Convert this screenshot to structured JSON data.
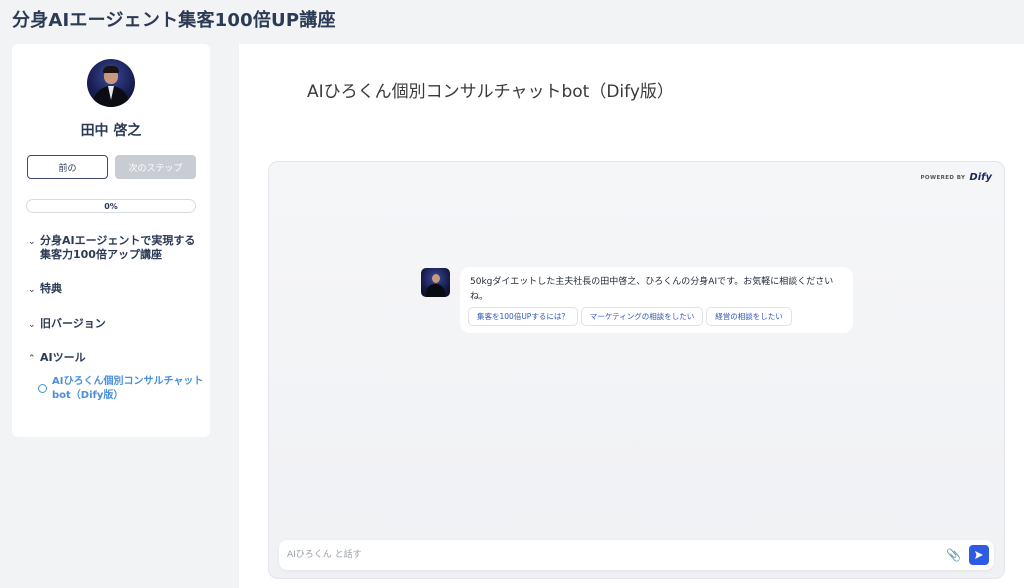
{
  "header": {
    "title": "分身AIエージェント集客100倍UP講座"
  },
  "sidebar": {
    "user_name": "田中 啓之",
    "prev_label": "前の",
    "next_label": "次のステップ",
    "progress": {
      "value": 0,
      "label": "0%"
    },
    "sections": [
      {
        "label": "分身AIエージェントで実現する集客力100倍アップ講座",
        "expanded": false,
        "icon": "chevron-down-icon"
      },
      {
        "label": "特典",
        "expanded": false,
        "icon": "chevron-down-icon"
      },
      {
        "label": "旧バージョン",
        "expanded": false,
        "icon": "chevron-down-icon"
      },
      {
        "label": "AIツール",
        "expanded": true,
        "icon": "chevron-up-icon",
        "items": [
          {
            "label": "AIひろくん個別コンサルチャットbot（Dify版）",
            "active": true
          }
        ]
      }
    ]
  },
  "main": {
    "title": "AIひろくん個別コンサルチャットbot（Dify版）",
    "chat": {
      "powered_by": "POWERED BY",
      "brand": "Dify",
      "bot_message": "50kgダイエットした主夫社長の田中啓之、ひろくんの分身AIです。お気軽に相談くださいね。",
      "suggestions": [
        "集客を100倍UPするには？",
        "マーケティングの相談をしたい",
        "経営の相談をしたい"
      ],
      "input_placeholder": "AIひろくん と話す",
      "accent": "#2d5be3"
    }
  },
  "colors": {
    "heading": "#2b3a55",
    "link": "#4a90d9"
  }
}
